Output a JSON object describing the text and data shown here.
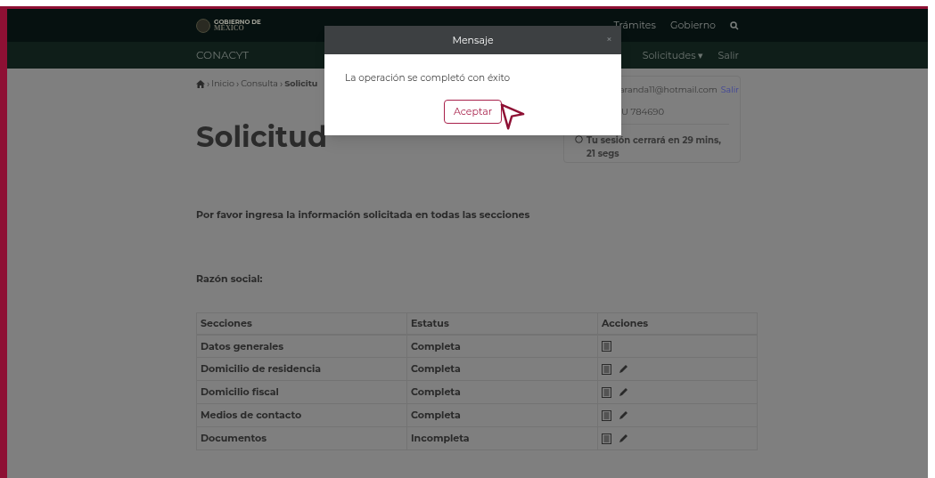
{
  "header": {
    "logo": "MÉXICO",
    "logo_small": "GOBIERNO DE",
    "links": [
      "Trámites",
      "Gobierno"
    ],
    "brand": "CONACYT",
    "nav": [
      "Solicitudes",
      "Salir"
    ],
    "nav_caret": "▾"
  },
  "breadcrumb_separator": "›",
  "breadcrumb": [
    "Inicio",
    "Consulta",
    "Solicitu"
  ],
  "title": "Solicitud",
  "session": {
    "email": "aranda11@hotmail.com",
    "logout": "Salir",
    "id": "U 784690",
    "timer": "Tu sesión cerrará en 29 mins, 21 segs"
  },
  "instructions": "Por favor ingresa la información solicitada en todas las secciones",
  "razon_label": "Razón social:",
  "table": {
    "columns": [
      "Secciones",
      "Estatus",
      "Acciones"
    ],
    "rows": [
      {
        "section": "Datos generales",
        "status": "Completa",
        "editable": false
      },
      {
        "section": "Domicilio de residencia",
        "status": "Completa",
        "editable": true
      },
      {
        "section": "Domicilio fiscal",
        "status": "Completa",
        "editable": true
      },
      {
        "section": "Medios de contacto",
        "status": "Completa",
        "editable": true
      },
      {
        "section": "Documentos",
        "status": "Incompleta",
        "editable": true
      }
    ]
  },
  "modal": {
    "title": "Mensaje",
    "close": "×",
    "message": "La operación se completó con éxito",
    "button": "Aceptar"
  }
}
